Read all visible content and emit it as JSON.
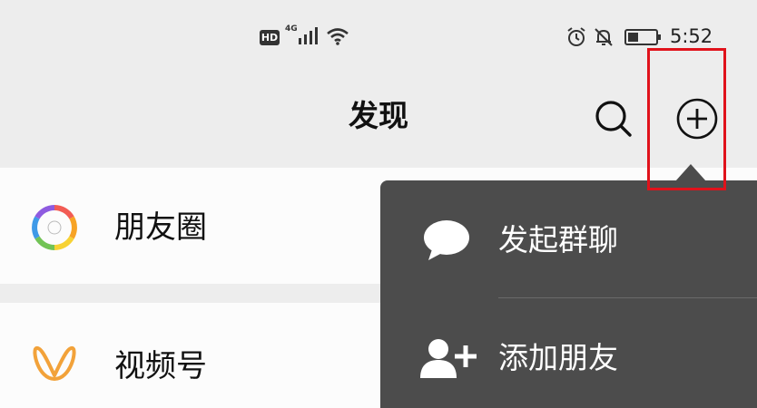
{
  "status_bar": {
    "hd_label": "HD",
    "network_label": "4G",
    "time": "5:52",
    "icons": [
      "hd-icon",
      "signal-icon",
      "wifi-icon",
      "alarm-icon",
      "mute-bell-icon",
      "battery-icon"
    ]
  },
  "header": {
    "title": "发现",
    "search_icon": "search-icon",
    "add_icon": "plus-circle-icon",
    "highlight_color": "#e0121b"
  },
  "list": {
    "items": [
      {
        "label": "朋友圈",
        "icon": "moments-aperture-icon"
      },
      {
        "label": "视频号",
        "icon": "channels-butterfly-icon"
      }
    ]
  },
  "popup_menu": {
    "background": "#4c4c4c",
    "items": [
      {
        "label": "发起群聊",
        "icon": "chat-bubble-icon"
      },
      {
        "label": "添加朋友",
        "icon": "add-friend-icon"
      }
    ]
  }
}
